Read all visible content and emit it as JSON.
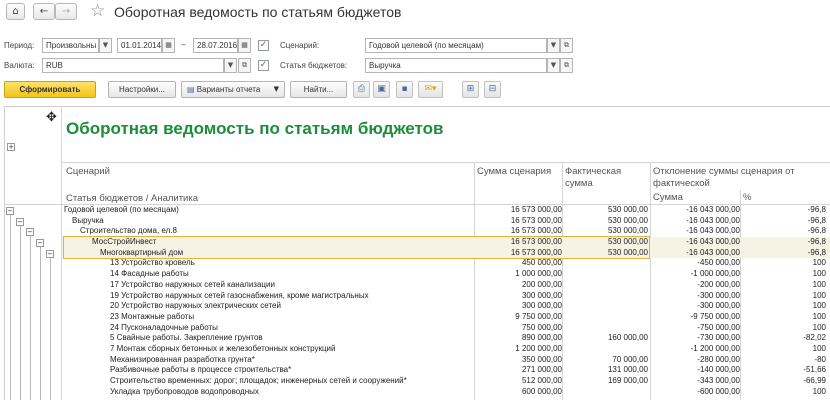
{
  "titlebar": {
    "title": "Оборотная ведомость по статьям бюджетов",
    "home_icon": "⌂",
    "back_icon": "←",
    "forward_icon": "→",
    "star_icon": "☆"
  },
  "filters": {
    "period_label": "Период:",
    "period_type": "Произвольны",
    "date_from": "01.01.2014",
    "date_sep": "–",
    "date_to": "28.07.2016",
    "currency_label": "Валюта:",
    "currency": "RUB",
    "scenario_label": "Сценарий:",
    "scenario": "Годовой целевой (по месяцам)",
    "budget_items_label": "Статья бюджетов:",
    "budget_item": "Выручка"
  },
  "toolbar": {
    "generate": "Сформировать",
    "settings": "Настройки...",
    "variants": "Варианты отчета",
    "find": "Найти..."
  },
  "report": {
    "title": "Оборотная ведомость по статьям бюджетов",
    "headers": {
      "scenario": "Сценарий",
      "budget_item": "Статья бюджетов / Аналитика",
      "plan_sum": "Сумма сценария",
      "fact_sum_line1": "Фактическая",
      "fact_sum_line2": "сумма",
      "deviation_line1": "Отклонение суммы сценария от",
      "deviation_line2": "фактической",
      "dev_sum": "Сумма",
      "dev_pct": "%"
    },
    "rows": [
      {
        "indent": 0,
        "name": "Годовой целевой (по месяцам)",
        "plan": "16 573 000,00",
        "fact": "530 000,00",
        "dev": "-16 043 000,00",
        "pct": "-96,8"
      },
      {
        "indent": 1,
        "name": "Выручка",
        "plan": "16 573 000,00",
        "fact": "530 000,00",
        "dev": "-16 043 000,00",
        "pct": "-96,8"
      },
      {
        "indent": 2,
        "name": "Строительство дома, ел.8",
        "plan": "16 573 000,00",
        "fact": "530 000,00",
        "dev": "-16 043 000,00",
        "pct": "-96,8"
      },
      {
        "indent": 3,
        "name": "МосСтройИнвест",
        "plan": "16 573 000,00",
        "fact": "530 000,00",
        "dev": "-16 043 000,00",
        "pct": "-96,8",
        "hl": true
      },
      {
        "indent": 4,
        "name": "Многоквартирный дом",
        "plan": "16 573 000,00",
        "fact": "530 000,00",
        "dev": "-16 043 000,00",
        "pct": "-96,8",
        "hl": true
      },
      {
        "indent": 5,
        "name": "13 Устройство кровель",
        "plan": "450 000,00",
        "fact": "",
        "dev": "-450 000,00",
        "pct": "100"
      },
      {
        "indent": 5,
        "name": "14 Фасадные работы",
        "plan": "1 000 000,00",
        "fact": "",
        "dev": "-1 000 000,00",
        "pct": "100"
      },
      {
        "indent": 5,
        "name": "17 Устройство наружных сетей канализации",
        "plan": "200 000,00",
        "fact": "",
        "dev": "-200 000,00",
        "pct": "100"
      },
      {
        "indent": 5,
        "name": "19 Устройство наружных сетей газоснабжения, кроме магистральных",
        "plan": "300 000,00",
        "fact": "",
        "dev": "-300 000,00",
        "pct": "100"
      },
      {
        "indent": 5,
        "name": "20 Устройство наружных электрических сетей",
        "plan": "300 000,00",
        "fact": "",
        "dev": "-300 000,00",
        "pct": "100"
      },
      {
        "indent": 5,
        "name": "23 Монтажные работы",
        "plan": "9 750 000,00",
        "fact": "",
        "dev": "-9 750 000,00",
        "pct": "100"
      },
      {
        "indent": 5,
        "name": "24 Пусконаладочные работы",
        "plan": "750 000,00",
        "fact": "",
        "dev": "-750 000,00",
        "pct": "100"
      },
      {
        "indent": 5,
        "name": "5 Свайные работы. Закрепление грунтов",
        "plan": "890 000,00",
        "fact": "160 000,00",
        "dev": "-730 000,00",
        "pct": "-82,02"
      },
      {
        "indent": 5,
        "name": "7 Монтаж сборных бетонных и железобетонных конструкций",
        "plan": "1 200 000,00",
        "fact": "",
        "dev": "-1 200 000,00",
        "pct": "100"
      },
      {
        "indent": 5,
        "name": "Механизированная разработка грунта*",
        "plan": "350 000,00",
        "fact": "70 000,00",
        "dev": "-280 000,00",
        "pct": "-80"
      },
      {
        "indent": 5,
        "name": "Разбивочные работы в процессе строительства*",
        "plan": "271 000,00",
        "fact": "131 000,00",
        "dev": "-140 000,00",
        "pct": "-51,66"
      },
      {
        "indent": 5,
        "name": "Строительство временных: дорог; площадок; инженерных сетей и сооружений*",
        "plan": "512 000,00",
        "fact": "169 000,00",
        "dev": "-343 000,00",
        "pct": "-66,99"
      },
      {
        "indent": 5,
        "name": "Укладка трубопроводов водопроводных",
        "plan": "600 000,00",
        "fact": "",
        "dev": "-600 000,00",
        "pct": "100"
      }
    ]
  },
  "colors": {
    "report_title": "#1c8d3b",
    "primary_button": "#f4c418",
    "selection": "#e4b43a"
  }
}
